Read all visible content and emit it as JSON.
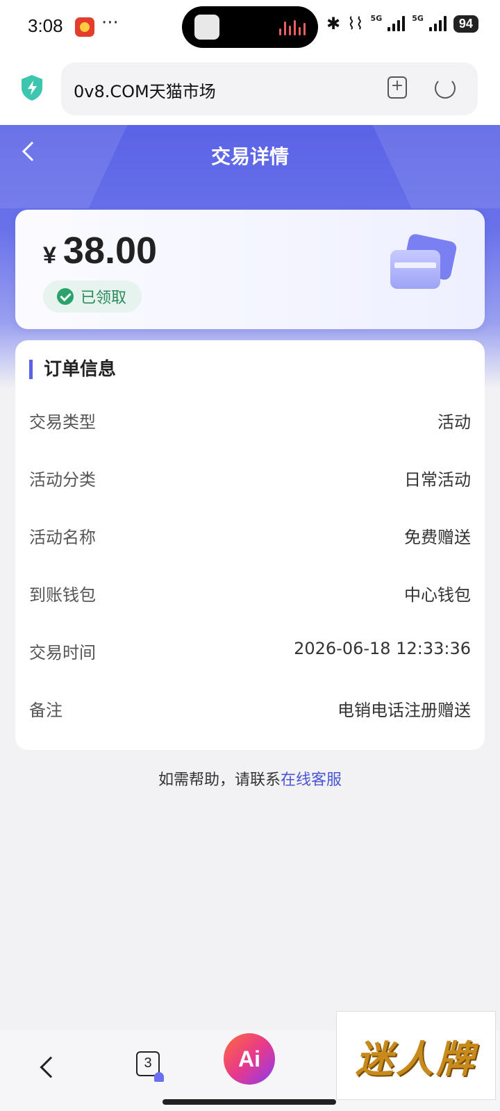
{
  "status_bar": {
    "time": "3:08",
    "more": "···",
    "battery": "94",
    "network": "5G"
  },
  "browser": {
    "url": "0v8.COM天猫市场",
    "bookmark_icon": "add-bookmark-icon",
    "reload_icon": "reload-icon"
  },
  "header": {
    "title": "交易详情"
  },
  "amount_card": {
    "currency": "¥",
    "amount": "38.00",
    "status": "已领取",
    "status_color": "#2aa36a"
  },
  "order": {
    "section_title": "订单信息",
    "rows": [
      {
        "label": "交易类型",
        "value": "活动"
      },
      {
        "label": "活动分类",
        "value": "日常活动"
      },
      {
        "label": "活动名称",
        "value": "免费赠送"
      },
      {
        "label": "到账钱包",
        "value": "中心钱包"
      },
      {
        "label": "交易时间",
        "value": "2026-06-18 12:33:36"
      },
      {
        "label": "备注",
        "value": "电销电话注册赠送"
      }
    ]
  },
  "help": {
    "prefix": "如需帮助，请联系",
    "link": "在线客服"
  },
  "bottom_nav": {
    "tab_count": "3",
    "ai_label": "Ai"
  },
  "watermark": "迷人牌",
  "colors": {
    "accent": "#5a63e6",
    "link": "#4a55d6"
  }
}
